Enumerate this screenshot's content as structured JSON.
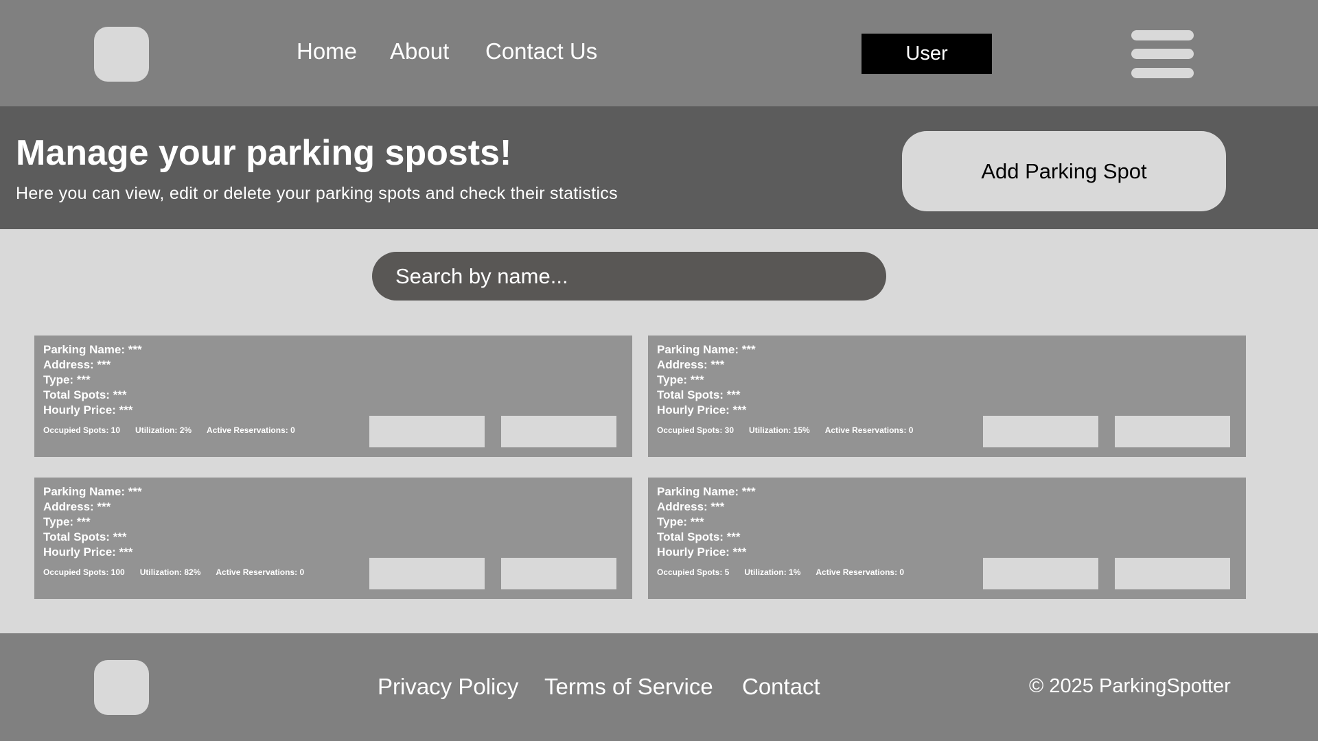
{
  "header": {
    "nav": [
      "Home",
      "About",
      "Contact Us"
    ],
    "user_label": "User"
  },
  "hero": {
    "title": "Manage your parking sposts!",
    "subtitle": "Here you can view, edit or delete your parking spots and check their statistics",
    "add_button": "Add Parking Spot"
  },
  "search": {
    "placeholder": "Search by name..."
  },
  "cards": [
    {
      "fields": [
        "Parking Name: ***",
        "Address: ***",
        "Type: ***",
        "Total Spots: ***",
        "Hourly Price: ***"
      ],
      "stats": [
        "Occupied Spots: 10",
        "Utilization: 2%",
        "Active Reservations: 0"
      ]
    },
    {
      "fields": [
        "Parking Name: ***",
        "Address: ***",
        "Type: ***",
        "Total Spots: ***",
        "Hourly Price: ***"
      ],
      "stats": [
        "Occupied Spots: 30",
        "Utilization: 15%",
        "Active Reservations: 0"
      ]
    },
    {
      "fields": [
        "Parking Name: ***",
        "Address: ***",
        "Type: ***",
        "Total Spots: ***",
        "Hourly Price: ***"
      ],
      "stats": [
        "Occupied Spots: 100",
        "Utilization: 82%",
        "Active Reservations: 0"
      ]
    },
    {
      "fields": [
        "Parking Name: ***",
        "Address: ***",
        "Type: ***",
        "Total Spots: ***",
        "Hourly Price: ***"
      ],
      "stats": [
        "Occupied Spots: 5",
        "Utilization: 1%",
        "Active Reservations: 0"
      ]
    }
  ],
  "footer": {
    "links": [
      "Privacy Policy",
      "Terms of Service",
      "Contact"
    ],
    "copyright": "© 2025 ParkingSpotter"
  },
  "icons": {
    "logo": "logo-placeholder",
    "menu": "hamburger-menu-icon"
  },
  "colors": {
    "header_bg": "#808080",
    "hero_bg": "#5c5c5c",
    "page_bg": "#d9d9d9",
    "card_bg": "#939393",
    "search_bg": "#595755",
    "user_button_bg": "#000000"
  }
}
